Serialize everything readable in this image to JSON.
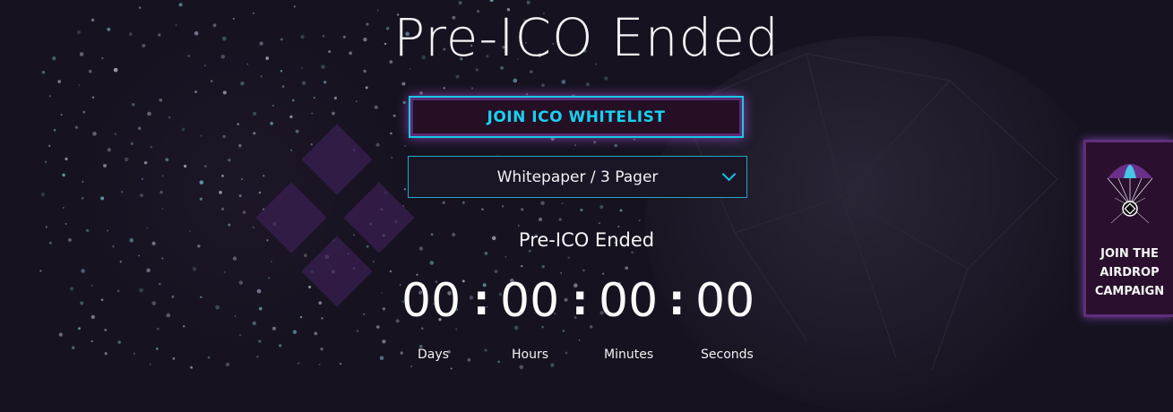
{
  "header": {
    "title": "Pre-ICO Ended"
  },
  "actions": {
    "whitelist_label": "JOIN ICO WHITELIST",
    "documents_dropdown_label": "Whitepaper / 3 Pager"
  },
  "countdown": {
    "status": "Pre-ICO Ended",
    "days": "00",
    "hours": "00",
    "minutes": "00",
    "seconds": "00",
    "separator": ":",
    "labels": {
      "days": "Days",
      "hours": "Hours",
      "minutes": "Minutes",
      "seconds": "Seconds"
    }
  },
  "airdrop": {
    "icon": "parachute-icon",
    "lines": [
      "JOIN THE",
      "AIRDROP",
      "CAMPAIGN"
    ]
  },
  "colors": {
    "background": "#16121f",
    "accent_cyan": "#19c7e8",
    "accent_purple": "#5f2f7a",
    "button_fill": "#240f25"
  }
}
